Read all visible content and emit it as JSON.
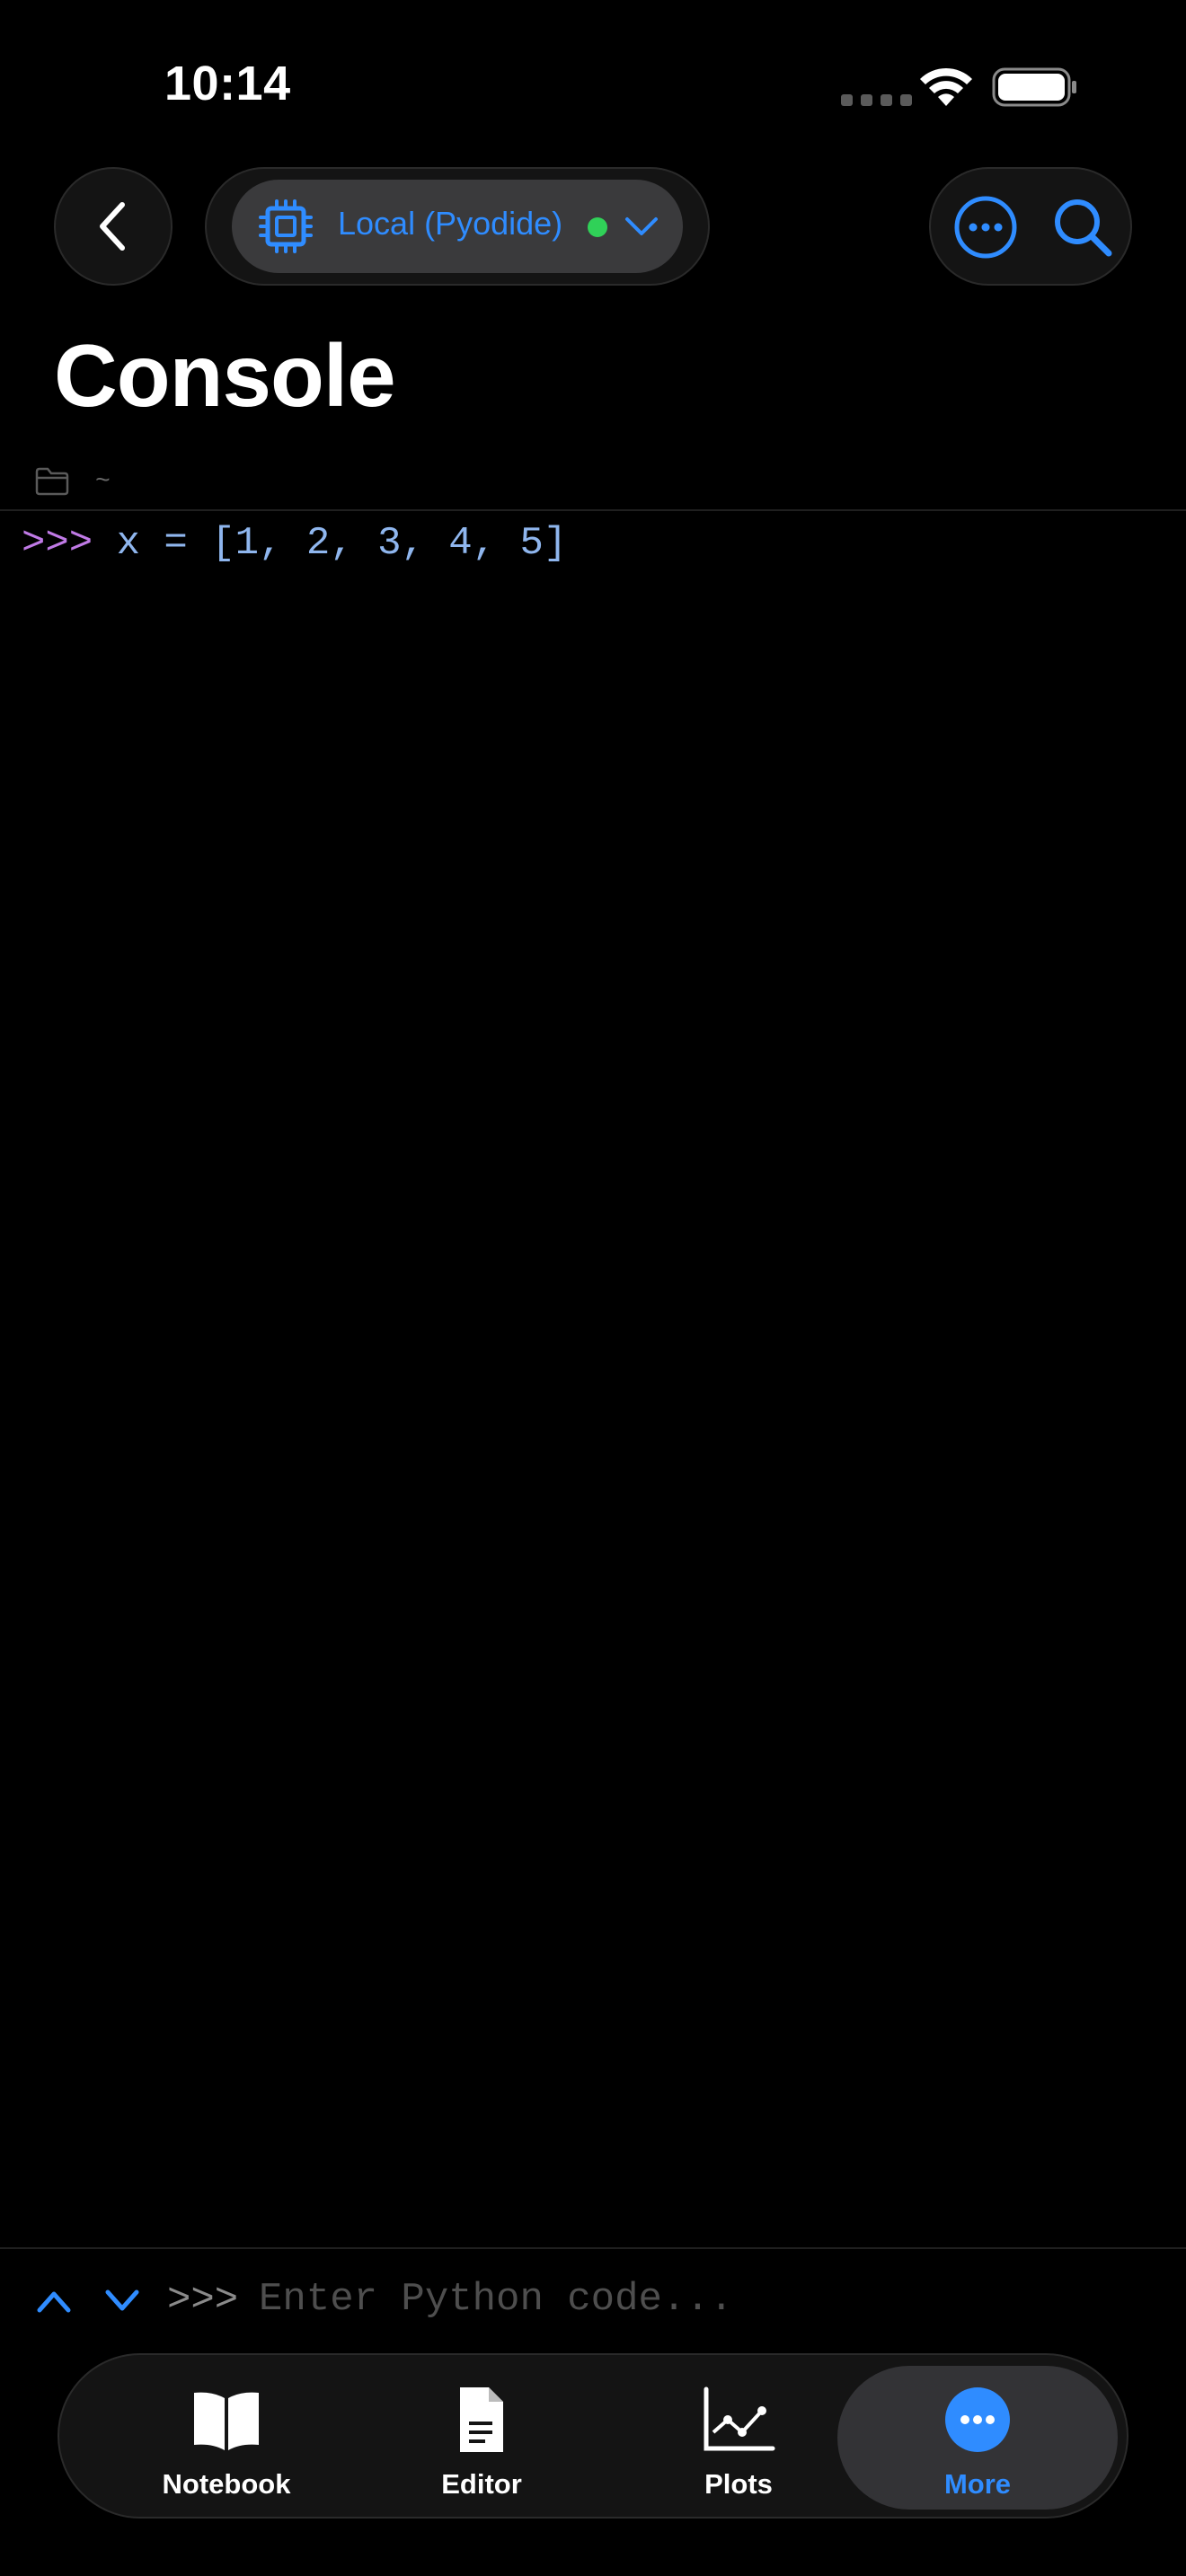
{
  "status_bar": {
    "time": "10:14"
  },
  "header": {
    "kernel_label": "Local (Pyodide)",
    "kernel_status_color": "#30d158",
    "accent_color": "#2f8cff",
    "title": "Console",
    "path": "~"
  },
  "console": {
    "lines": [
      {
        "prompt": ">>>",
        "code": " x = [1, 2, 3, 4, 5]"
      }
    ]
  },
  "input_bar": {
    "prompt": ">>>",
    "placeholder": "Enter Python code..."
  },
  "tab_bar": {
    "tabs": [
      {
        "label": "Notebook",
        "icon": "book-icon",
        "active": false
      },
      {
        "label": "Editor",
        "icon": "document-icon",
        "active": false
      },
      {
        "label": "Plots",
        "icon": "chart-icon",
        "active": false
      },
      {
        "label": "More",
        "icon": "more-icon",
        "active": true
      }
    ]
  }
}
